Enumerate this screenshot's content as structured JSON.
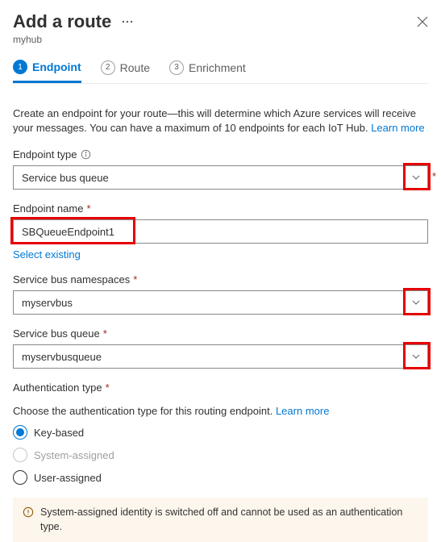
{
  "header": {
    "title": "Add a route",
    "subtitle": "myhub"
  },
  "steps": [
    {
      "num": "1",
      "label": "Endpoint",
      "active": true
    },
    {
      "num": "2",
      "label": "Route",
      "active": false
    },
    {
      "num": "3",
      "label": "Enrichment",
      "active": false
    }
  ],
  "intro": {
    "text": "Create an endpoint for your route—this will determine which Azure services will receive your messages. You can have a maximum of 10 endpoints for each IoT Hub. ",
    "learn_more": "Learn more"
  },
  "fields": {
    "endpoint_type": {
      "label": "Endpoint type",
      "value": "Service bus queue"
    },
    "endpoint_name": {
      "label": "Endpoint name",
      "value": "SBQueueEndpoint1",
      "select_existing": "Select existing"
    },
    "namespaces": {
      "label": "Service bus namespaces",
      "value": "myservbus"
    },
    "queue": {
      "label": "Service bus queue",
      "value": "myservbusqueue"
    }
  },
  "auth": {
    "label": "Authentication type",
    "intro": "Choose the authentication type for this routing endpoint. ",
    "learn_more": "Learn more",
    "options": {
      "key": "Key-based",
      "system": "System-assigned",
      "user": "User-assigned"
    },
    "banner": "System-assigned identity is switched off and cannot be used as an authentication type."
  }
}
